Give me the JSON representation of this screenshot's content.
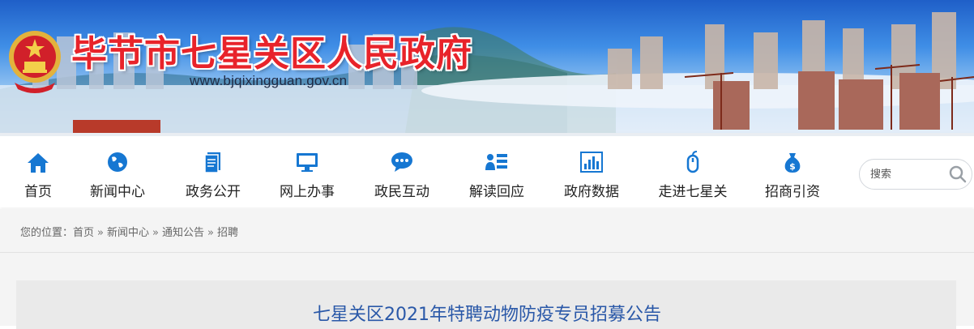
{
  "banner": {
    "title": "毕节市七星关区人民政府",
    "url": "www.bjqixingguan.gov.cn",
    "emblem_icon": "national-emblem-icon",
    "title_color": "#e8232a"
  },
  "nav": {
    "items": [
      {
        "label": "首页",
        "icon": "home-icon"
      },
      {
        "label": "新闻中心",
        "icon": "globe-icon"
      },
      {
        "label": "政务公开",
        "icon": "document-icon"
      },
      {
        "label": "网上办事",
        "icon": "monitor-icon"
      },
      {
        "label": "政民互动",
        "icon": "chat-bubble-icon"
      },
      {
        "label": "解读回应",
        "icon": "person-list-icon"
      },
      {
        "label": "政府数据",
        "icon": "bar-chart-icon"
      },
      {
        "label": "走进七星关",
        "icon": "mouse-icon"
      },
      {
        "label": "招商引资",
        "icon": "money-bag-icon"
      }
    ],
    "icon_color": "#1677d2"
  },
  "search": {
    "placeholder": "搜索"
  },
  "breadcrumb": {
    "prefix": "您的位置：",
    "items": [
      "首页",
      "新闻中心",
      "通知公告",
      "招聘"
    ],
    "separator": "»"
  },
  "article": {
    "title": "七星关区2021年特聘动物防疫专员招募公告",
    "title_color": "#2a58a8"
  }
}
